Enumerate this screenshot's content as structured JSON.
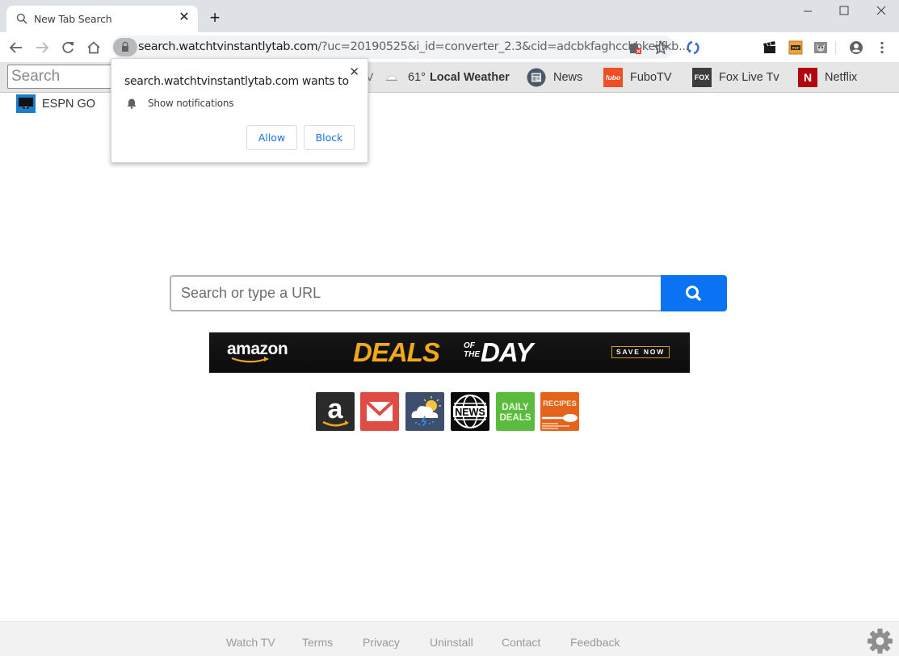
{
  "browser": {
    "tab": {
      "title": "New Tab Search"
    },
    "new_tab_symbol": "+",
    "window_controls": {
      "minimize": "—",
      "maximize": "☐",
      "close": "✕"
    },
    "omnibox": {
      "url_host": "search.watchtvinstantlytab.com",
      "url_rest": "/?uc=20190525&i_id=converter_2.3&cid=adcbkfaghcchbkeijfkb..."
    },
    "toolbar_icons": [
      "back-icon",
      "forward-icon",
      "reload-icon",
      "home-icon",
      "lock-icon",
      "extension-blocked-icon",
      "star-icon",
      "sync-extension-icon",
      "clapperboard-extension-icon",
      "pdf-extension-icon",
      "cat-extension-icon",
      "profile-icon",
      "menu-icon"
    ]
  },
  "bookmark_bar": {
    "search_placeholder": "Search",
    "partial_label": "V",
    "weather": {
      "temp": "61°",
      "label": "Local Weather"
    },
    "items": [
      {
        "label": "News",
        "icon": "news-icon"
      },
      {
        "label": "FuboTV",
        "icon": "fubo-icon",
        "icon_text": "fubo"
      },
      {
        "label": "Fox Live Tv",
        "icon": "fox-icon",
        "icon_text": "FOX"
      },
      {
        "label": "Netflix",
        "icon": "netflix-icon",
        "icon_text": "N"
      }
    ],
    "overflow_item": {
      "label": "ESPN GO",
      "icon": "tv-icon"
    }
  },
  "notification_prompt": {
    "title": "search.watchtvinstantlytab.com wants to",
    "permission": "Show notifications",
    "allow_label": "Allow",
    "block_label": "Block",
    "close_symbol": "✕"
  },
  "main": {
    "search_placeholder": "Search or type a URL",
    "banner": {
      "brand": "amazon",
      "headline_1": "DEALS",
      "headline_of": "OF",
      "headline_the": "THE",
      "headline_2": "DAY",
      "cta": "SAVE NOW"
    },
    "tiles": [
      {
        "name": "amazon",
        "text": "a",
        "color": "#2a2a2a"
      },
      {
        "name": "gmail",
        "text": "",
        "color": "#e04b43"
      },
      {
        "name": "weather",
        "text": "",
        "color": "#3d4f6d"
      },
      {
        "name": "news",
        "text": "NEWS",
        "color": "#0a0a0a"
      },
      {
        "name": "daily-deals",
        "text_1": "DAILY",
        "text_2": "DEALS",
        "color": "#5bbb3f"
      },
      {
        "name": "recipes",
        "text": "RECIPES",
        "color": "#e5641c"
      }
    ]
  },
  "footer": {
    "links": [
      "Watch TV",
      "Terms",
      "Privacy",
      "Uninstall",
      "Contact",
      "Feedback"
    ]
  },
  "colors": {
    "accent_blue": "#0a73f3",
    "link_blue": "#1a73e8",
    "banner_gold": "#f0a81c"
  }
}
